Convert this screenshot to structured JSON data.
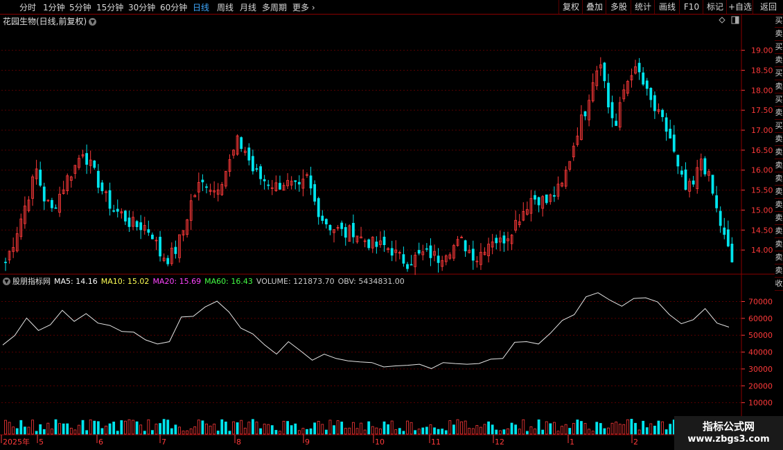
{
  "toolbar": {
    "left_items": [
      "分时",
      "1分钟",
      "5分钟",
      "15分钟",
      "30分钟",
      "60分钟",
      "日线",
      "周线",
      "月线",
      "多周期",
      "更多"
    ],
    "active": "日线",
    "right_items": [
      "复权",
      "叠加",
      "多股",
      "统计",
      "画线",
      "F10",
      "标记",
      "+自选",
      "返回"
    ]
  },
  "stock": {
    "title": "花园生物(日线,前复权)"
  },
  "indicator": {
    "name": "股朋指标网",
    "ma5_label": "MA5: 14.16",
    "ma10_label": "MA10: 15.02",
    "ma20_label": "MA20: 15.69",
    "ma60_label": "MA60: 16.43",
    "volume_label": "VOLUME: 121873.70",
    "obv_label": "OBV: 5434831.00"
  },
  "price_axis": [
    "19.00",
    "18.50",
    "18.00",
    "17.50",
    "17.00",
    "16.50",
    "16.00",
    "15.50",
    "15.00",
    "14.50",
    "14.00"
  ],
  "obv_axis": [
    "70000",
    "60000",
    "50000",
    "40000",
    "30000",
    "20000",
    "10000"
  ],
  "months": [
    "2025年",
    "5",
    "6",
    "7",
    "8",
    "9",
    "10",
    "11",
    "12",
    "1",
    "2"
  ],
  "side_column": [
    "买",
    "卖",
    "买",
    "卖",
    "买",
    "卖",
    "买",
    "卖",
    "买",
    "卖",
    "卖",
    "卖",
    "卖",
    "卖",
    "卖",
    "卖",
    "卖",
    "卖",
    "卖",
    "卖",
    "收"
  ],
  "watermark": {
    "line1": "指标公式网",
    "line2": "www.zbgs3.com"
  },
  "colors": {
    "up": "#ff3a3a",
    "down": "#00e5ee",
    "obv_line": "#e6e6e6",
    "ma5": "#ffffff",
    "ma10": "#ffff55",
    "ma20": "#ff44ff",
    "ma60": "#44ff44",
    "active_tab": "#3fa9ff"
  },
  "chart_data": {
    "type": "candlestick",
    "title": "花园生物(日线,前复权)",
    "ylim": [
      13.5,
      19.6
    ],
    "x_months": [
      "2025年",
      "5",
      "6",
      "7",
      "8",
      "9",
      "10",
      "11",
      "12",
      "1",
      "2"
    ],
    "closes": [
      13.7,
      14.2,
      14.8,
      15.4,
      16.0,
      15.3,
      15.0,
      15.4,
      15.8,
      16.1,
      16.5,
      16.1,
      15.7,
      15.3,
      15.0,
      14.9,
      14.7,
      14.6,
      14.6,
      14.4,
      13.9,
      13.8,
      14.0,
      14.5,
      15.2,
      15.6,
      15.7,
      15.5,
      15.8,
      16.2,
      16.7,
      16.5,
      16.0,
      15.8,
      15.7,
      15.6,
      15.7,
      15.6,
      15.5,
      15.8,
      15.2,
      14.8,
      14.6,
      14.5,
      14.4,
      14.5,
      14.3,
      14.2,
      14.1,
      14.1,
      14.0,
      13.8,
      13.7,
      13.8,
      13.9,
      13.9,
      13.8,
      14.0,
      14.1,
      14.2,
      14.0,
      13.8,
      14.1,
      14.3,
      14.2,
      14.4,
      14.7,
      15.0,
      15.3,
      15.3,
      15.2,
      15.4,
      15.6,
      16.3,
      17.0,
      17.5,
      18.3,
      18.8,
      17.6,
      17.1,
      18.0,
      18.5,
      18.4,
      17.9,
      17.5,
      17.2,
      16.8,
      16.0,
      15.5,
      15.6,
      16.3,
      15.8,
      15.0,
      14.3,
      13.7
    ],
    "obv": [
      45000,
      49000,
      61000,
      52000,
      57000,
      64000,
      59000,
      62000,
      58000,
      55000,
      53000,
      51000,
      48000,
      44000,
      47000,
      60000,
      62000,
      66000,
      71000,
      63000,
      55000,
      50000,
      45000,
      38000,
      47000,
      40000,
      36000,
      38000,
      37000,
      34000,
      35000,
      33000,
      32000,
      31000,
      33000,
      32000,
      31000,
      33000,
      34000,
      32000,
      34000,
      35000,
      37000,
      45000,
      47000,
      44000,
      52000,
      58000,
      63000,
      72000,
      76000,
      70000,
      68000,
      71000,
      73000,
      69000,
      63000,
      56000,
      60000,
      65000,
      58000,
      54000
    ]
  }
}
